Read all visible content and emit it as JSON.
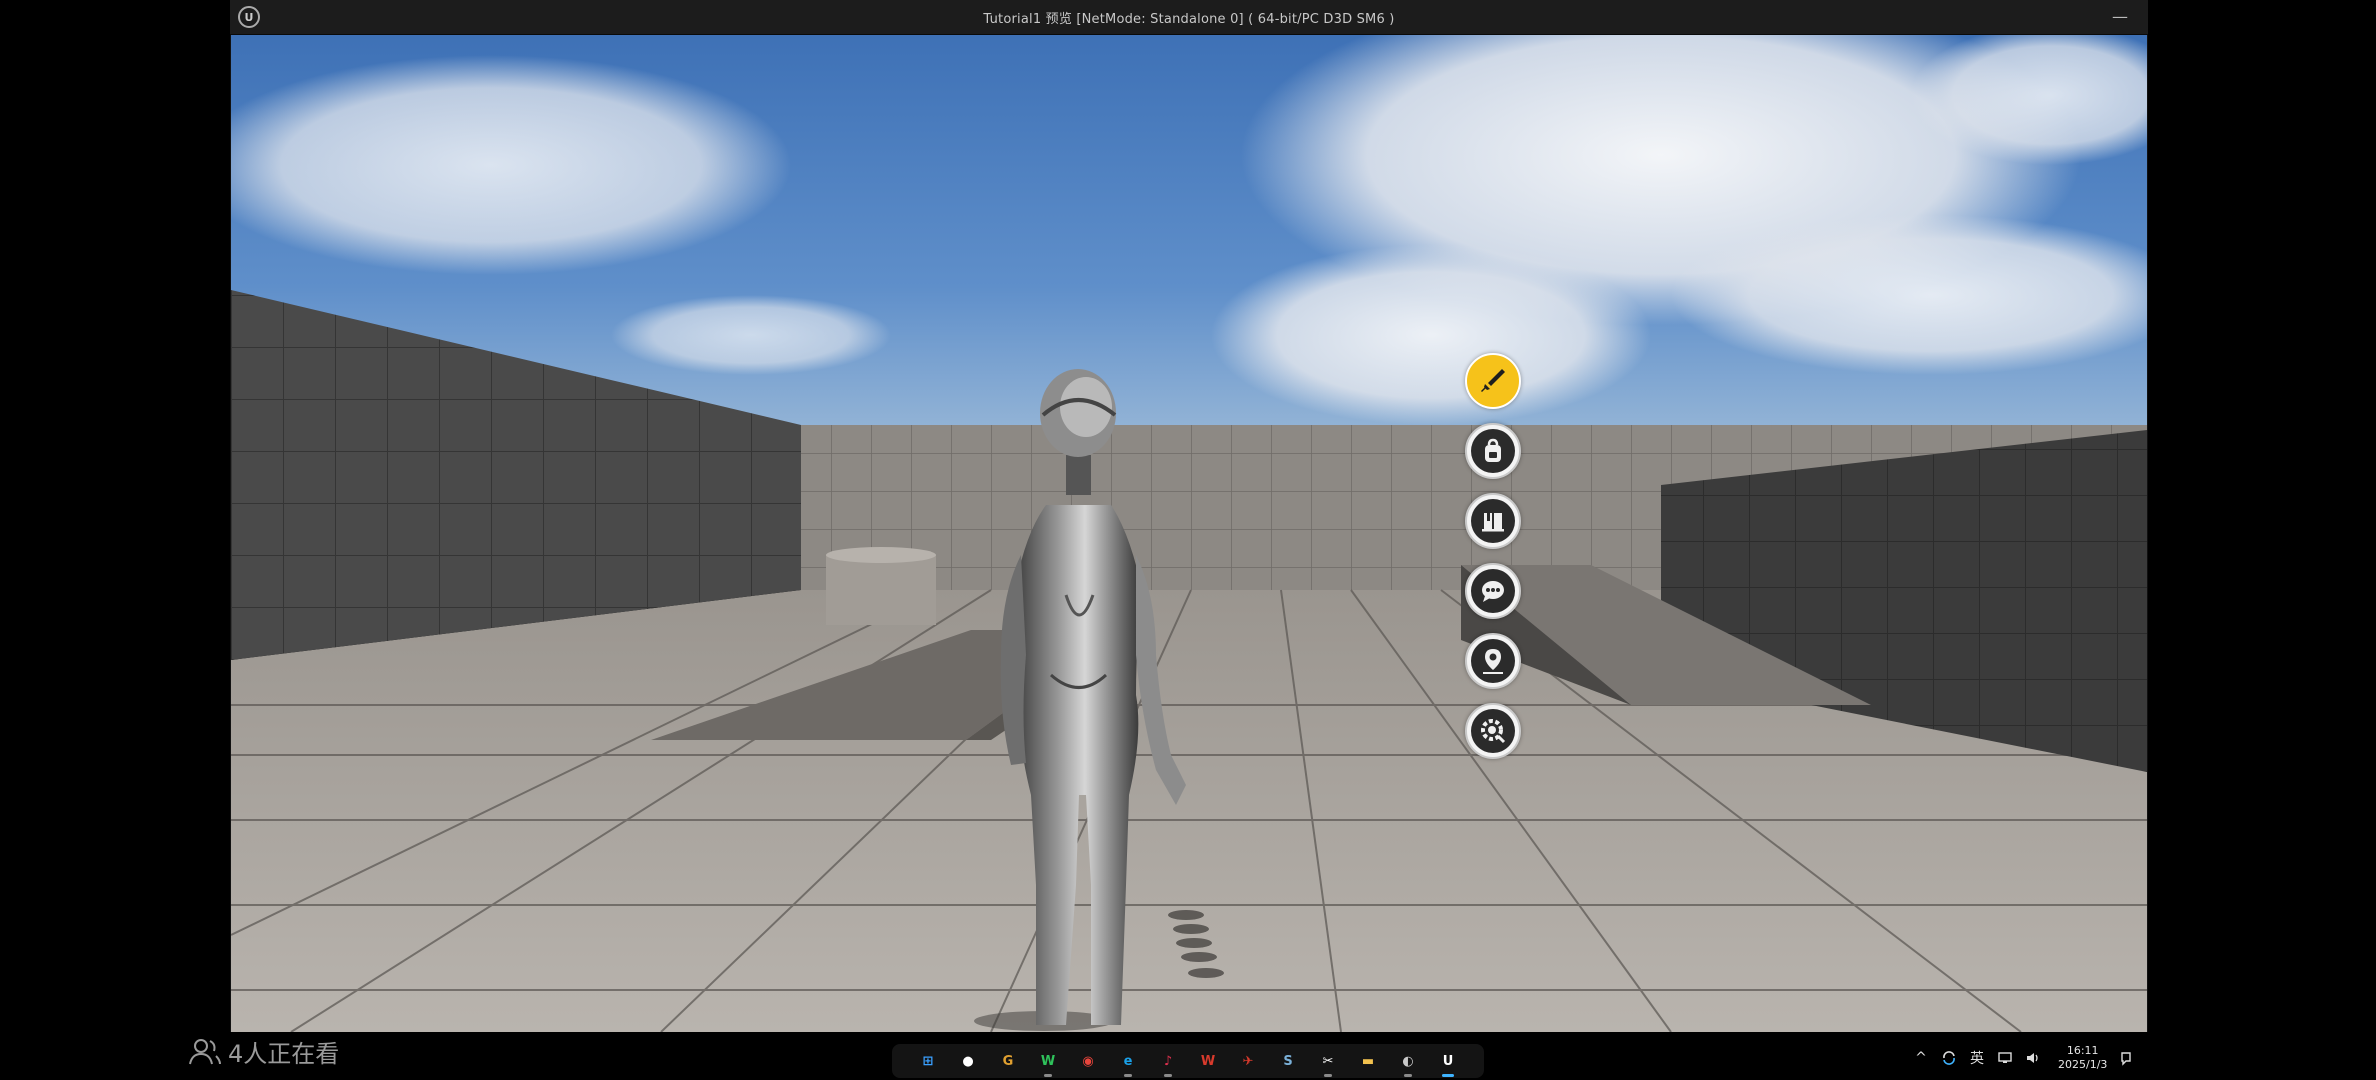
{
  "window": {
    "title": "Tutorial1 预览 [NetMode: Standalone 0]  ( 64-bit/PC D3D SM6 )",
    "logo_text": "U",
    "minimize_glyph": "—"
  },
  "radial_menu": {
    "accent_color": "#f6c21a",
    "items": [
      {
        "icon": "sword-icon",
        "active": true
      },
      {
        "icon": "backpack-icon",
        "active": false
      },
      {
        "icon": "quest-book-icon",
        "active": false
      },
      {
        "icon": "chat-icon",
        "active": false
      },
      {
        "icon": "map-pin-icon",
        "active": false
      },
      {
        "icon": "settings-icon",
        "active": false
      }
    ]
  },
  "stream_overlay": {
    "viewers_text": "4人正在看"
  },
  "taskbar": {
    "apps": [
      {
        "name": "windows-start",
        "glyph": "⊞",
        "color": "#3aa0ff",
        "running": "none"
      },
      {
        "name": "github",
        "glyph": "●",
        "color": "#ffffff",
        "running": "none"
      },
      {
        "name": "grammarly",
        "glyph": "G",
        "color": "#e0a030",
        "running": "none"
      },
      {
        "name": "wechat",
        "glyph": "W",
        "color": "#2fc25b",
        "running": "open"
      },
      {
        "name": "chrome",
        "glyph": "◉",
        "color": "#e8453c",
        "running": "none"
      },
      {
        "name": "edge",
        "glyph": "e",
        "color": "#1aa0e8",
        "running": "open"
      },
      {
        "name": "music",
        "glyph": "♪",
        "color": "#e0314f",
        "running": "open"
      },
      {
        "name": "wps",
        "glyph": "W",
        "color": "#d83a2c",
        "running": "none"
      },
      {
        "name": "netease",
        "glyph": "✈",
        "color": "#d83a2c",
        "running": "none"
      },
      {
        "name": "steam",
        "glyph": "S",
        "color": "#7ab0d8",
        "running": "none"
      },
      {
        "name": "capcut",
        "glyph": "✂",
        "color": "#ffffff",
        "running": "open"
      },
      {
        "name": "file-explorer",
        "glyph": "▬",
        "color": "#f2c14e",
        "running": "none"
      },
      {
        "name": "obs",
        "glyph": "◐",
        "color": "#c9c9c9",
        "running": "open"
      },
      {
        "name": "unreal-engine",
        "glyph": "U",
        "color": "#ffffff",
        "running": "active"
      }
    ],
    "tray": {
      "chevron": "^",
      "language": "英",
      "time": "16:11",
      "date": "2025/1/3"
    }
  }
}
